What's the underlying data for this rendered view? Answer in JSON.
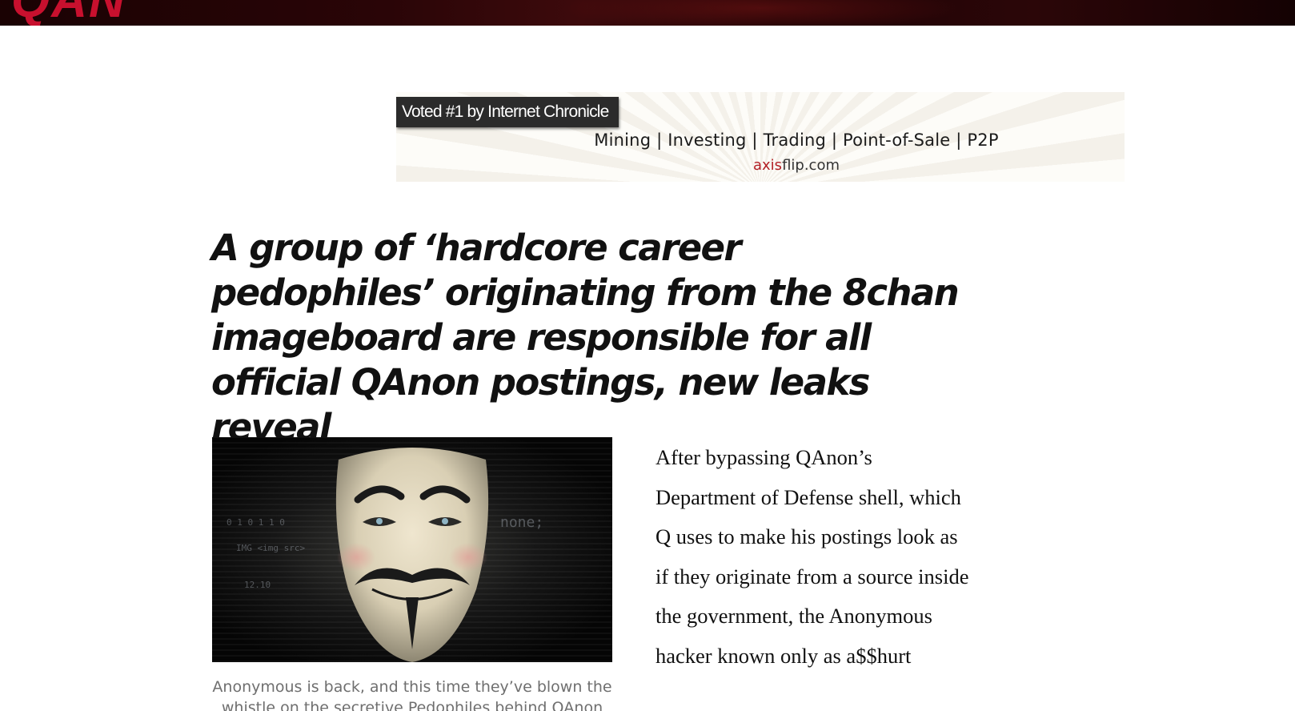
{
  "header": {
    "logo_text": "QAN",
    "background_color": "#2a0507",
    "logo_color": "#c8102e"
  },
  "advertisement": {
    "badge": "Voted #1 by Internet Chronicle",
    "services": "Mining | Investing | Trading | Point-of-Sale | P2P",
    "domain_accent": "axis",
    "domain_rest": "flip.com",
    "accent_color": "#b21e24"
  },
  "article": {
    "headline": "A group of ‘hardcore career pedophiles’ originating from the 8chan imageboard are responsible for all official QAnon postings, new leaks reveal",
    "featured_image": {
      "icon": "anonymous-mask-icon",
      "caption": "Anonymous is back, and this time they’ve blown the whistle on the secretive Pedophiles behind QAnon"
    },
    "body_text": "After bypassing QAnon’s Department of Defense shell, which Q uses to make his postings look as if they originate from a source inside the government, the Anonymous hacker known only as a$$hurt"
  }
}
